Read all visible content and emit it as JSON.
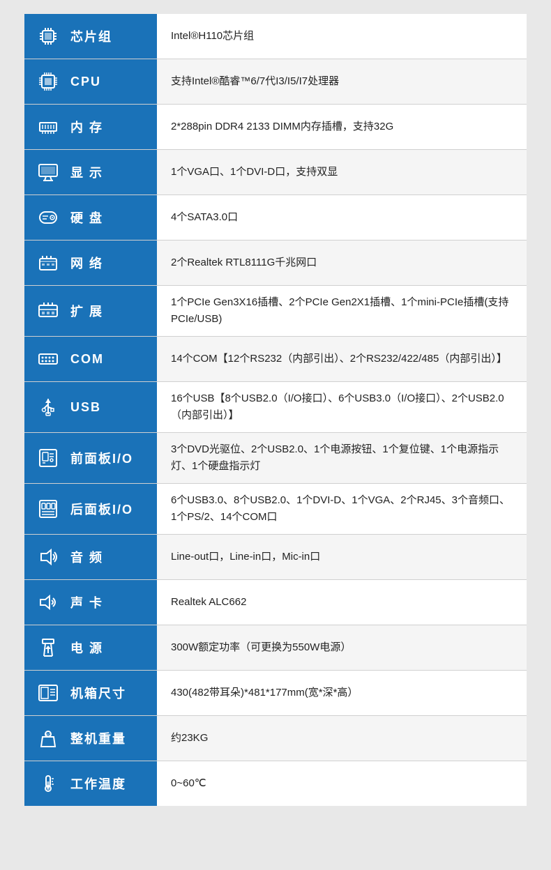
{
  "rows": [
    {
      "id": "chipset",
      "icon": "chipset",
      "label": "芯片组",
      "value": "Intel®H110芯片组"
    },
    {
      "id": "cpu",
      "icon": "cpu",
      "label": "CPU",
      "value": "支持Intel®酷睿™6/7代I3/I5/I7处理器"
    },
    {
      "id": "memory",
      "icon": "memory",
      "label": "内  存",
      "value": "2*288pin DDR4 2133 DIMM内存插槽，支持32G"
    },
    {
      "id": "display",
      "icon": "display",
      "label": "显  示",
      "value": "1个VGA口、1个DVI-D口，支持双显"
    },
    {
      "id": "hdd",
      "icon": "hdd",
      "label": "硬  盘",
      "value": "4个SATA3.0口"
    },
    {
      "id": "network",
      "icon": "network",
      "label": "网  络",
      "value": "2个Realtek RTL8111G千兆网口"
    },
    {
      "id": "expansion",
      "icon": "expansion",
      "label": "扩  展",
      "value": "1个PCIe Gen3X16插槽、2个PCIe Gen2X1插槽、1个mini-PCIe插槽(支持PCIe/USB)"
    },
    {
      "id": "com",
      "icon": "com",
      "label": "COM",
      "value": "14个COM【12个RS232（内部引出）、2个RS232/422/485（内部引出）】"
    },
    {
      "id": "usb",
      "icon": "usb",
      "label": "USB",
      "value": "16个USB【8个USB2.0（I/O接口）、6个USB3.0（I/O接口）、2个USB2.0（内部引出）】"
    },
    {
      "id": "front-io",
      "icon": "front-panel",
      "label": "前面板I/O",
      "value": "3个DVD光驱位、2个USB2.0、1个电源按钮、1个复位键、1个电源指示灯、1个硬盘指示灯"
    },
    {
      "id": "rear-io",
      "icon": "rear-panel",
      "label": "后面板I/O",
      "value": "6个USB3.0、8个USB2.0、1个DVI-D、1个VGA、2个RJ45、3个音频口、1个PS/2、14个COM口"
    },
    {
      "id": "audio",
      "icon": "audio",
      "label": "音  频",
      "value": "Line-out口，Line-in口，Mic-in口"
    },
    {
      "id": "sound-card",
      "icon": "sound-card",
      "label": "声  卡",
      "value": "Realtek ALC662"
    },
    {
      "id": "power",
      "icon": "power",
      "label": "电  源",
      "value": "300W额定功率（可更换为550W电源）"
    },
    {
      "id": "chassis-size",
      "icon": "chassis",
      "label": "机箱尺寸",
      "value": "430(482带耳朵)*481*177mm(宽*深*高）"
    },
    {
      "id": "weight",
      "icon": "weight",
      "label": "整机重量",
      "value": "约23KG"
    },
    {
      "id": "temperature",
      "icon": "temperature",
      "label": "工作温度",
      "value": "0~60℃"
    }
  ]
}
